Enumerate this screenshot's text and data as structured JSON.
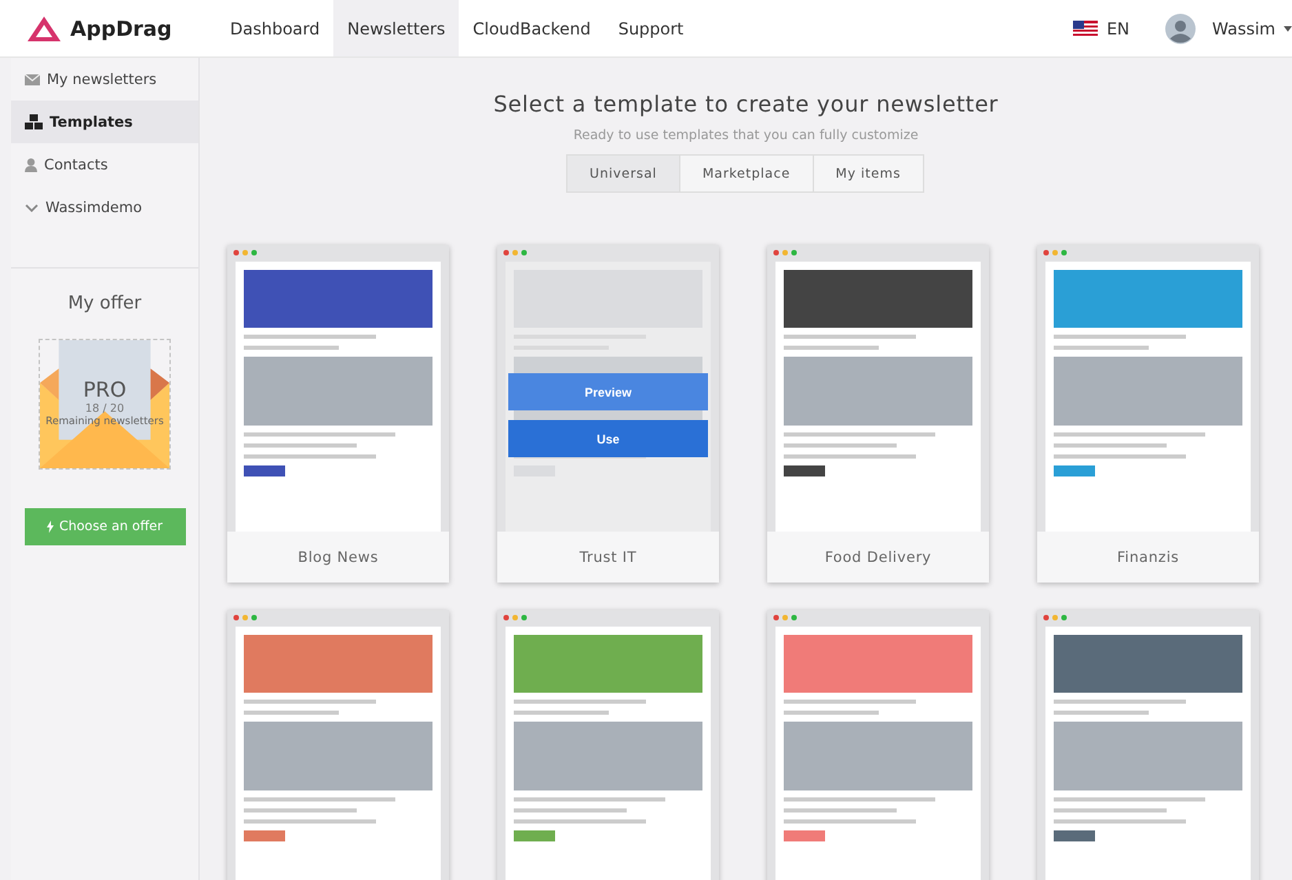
{
  "header": {
    "logo": "AppDrag",
    "nav": [
      {
        "label": "Dashboard",
        "selected": false
      },
      {
        "label": "Newsletters",
        "selected": true
      },
      {
        "label": "CloudBackend",
        "selected": false
      },
      {
        "label": "Support",
        "selected": false
      }
    ],
    "language": "EN",
    "user": "Wassim"
  },
  "sidebar": {
    "items": [
      {
        "kind": "mail",
        "label": "My newsletters",
        "selected": false
      },
      {
        "kind": "templates",
        "label": "Templates",
        "selected": true
      },
      {
        "kind": "user",
        "label": "Contacts",
        "selected": false
      },
      {
        "kind": "chevron",
        "label": "Wassimdemo",
        "selected": false
      }
    ],
    "offer": {
      "title": "My offer",
      "plan": "PRO",
      "count": "18 / 20",
      "caption": "Remaining newsletters",
      "button": "Choose an offer"
    }
  },
  "main": {
    "title": "Select a template to create your newsletter",
    "subtitle": "Ready to use templates that you can fully customize",
    "tabs": [
      {
        "label": "Universal",
        "selected": true
      },
      {
        "label": "Marketplace",
        "selected": false
      },
      {
        "label": "My items",
        "selected": false
      }
    ],
    "templates": [
      {
        "name": "Blog News",
        "color": "#3f51b5",
        "hovered": false
      },
      {
        "name": "Trust IT",
        "color": "#cfd3d8",
        "hovered": true,
        "actions": [
          "Preview",
          "Use"
        ]
      },
      {
        "name": "Food Delivery",
        "color": "#444444",
        "hovered": false
      },
      {
        "name": "Finanzis",
        "color": "#2a9fd6",
        "hovered": false
      },
      {
        "color": "#e07a5f",
        "hovered": false
      },
      {
        "color": "#6fae4f",
        "hovered": false
      },
      {
        "color": "#f07b78",
        "hovered": false
      },
      {
        "color": "#5a6b7a",
        "hovered": false
      }
    ]
  }
}
